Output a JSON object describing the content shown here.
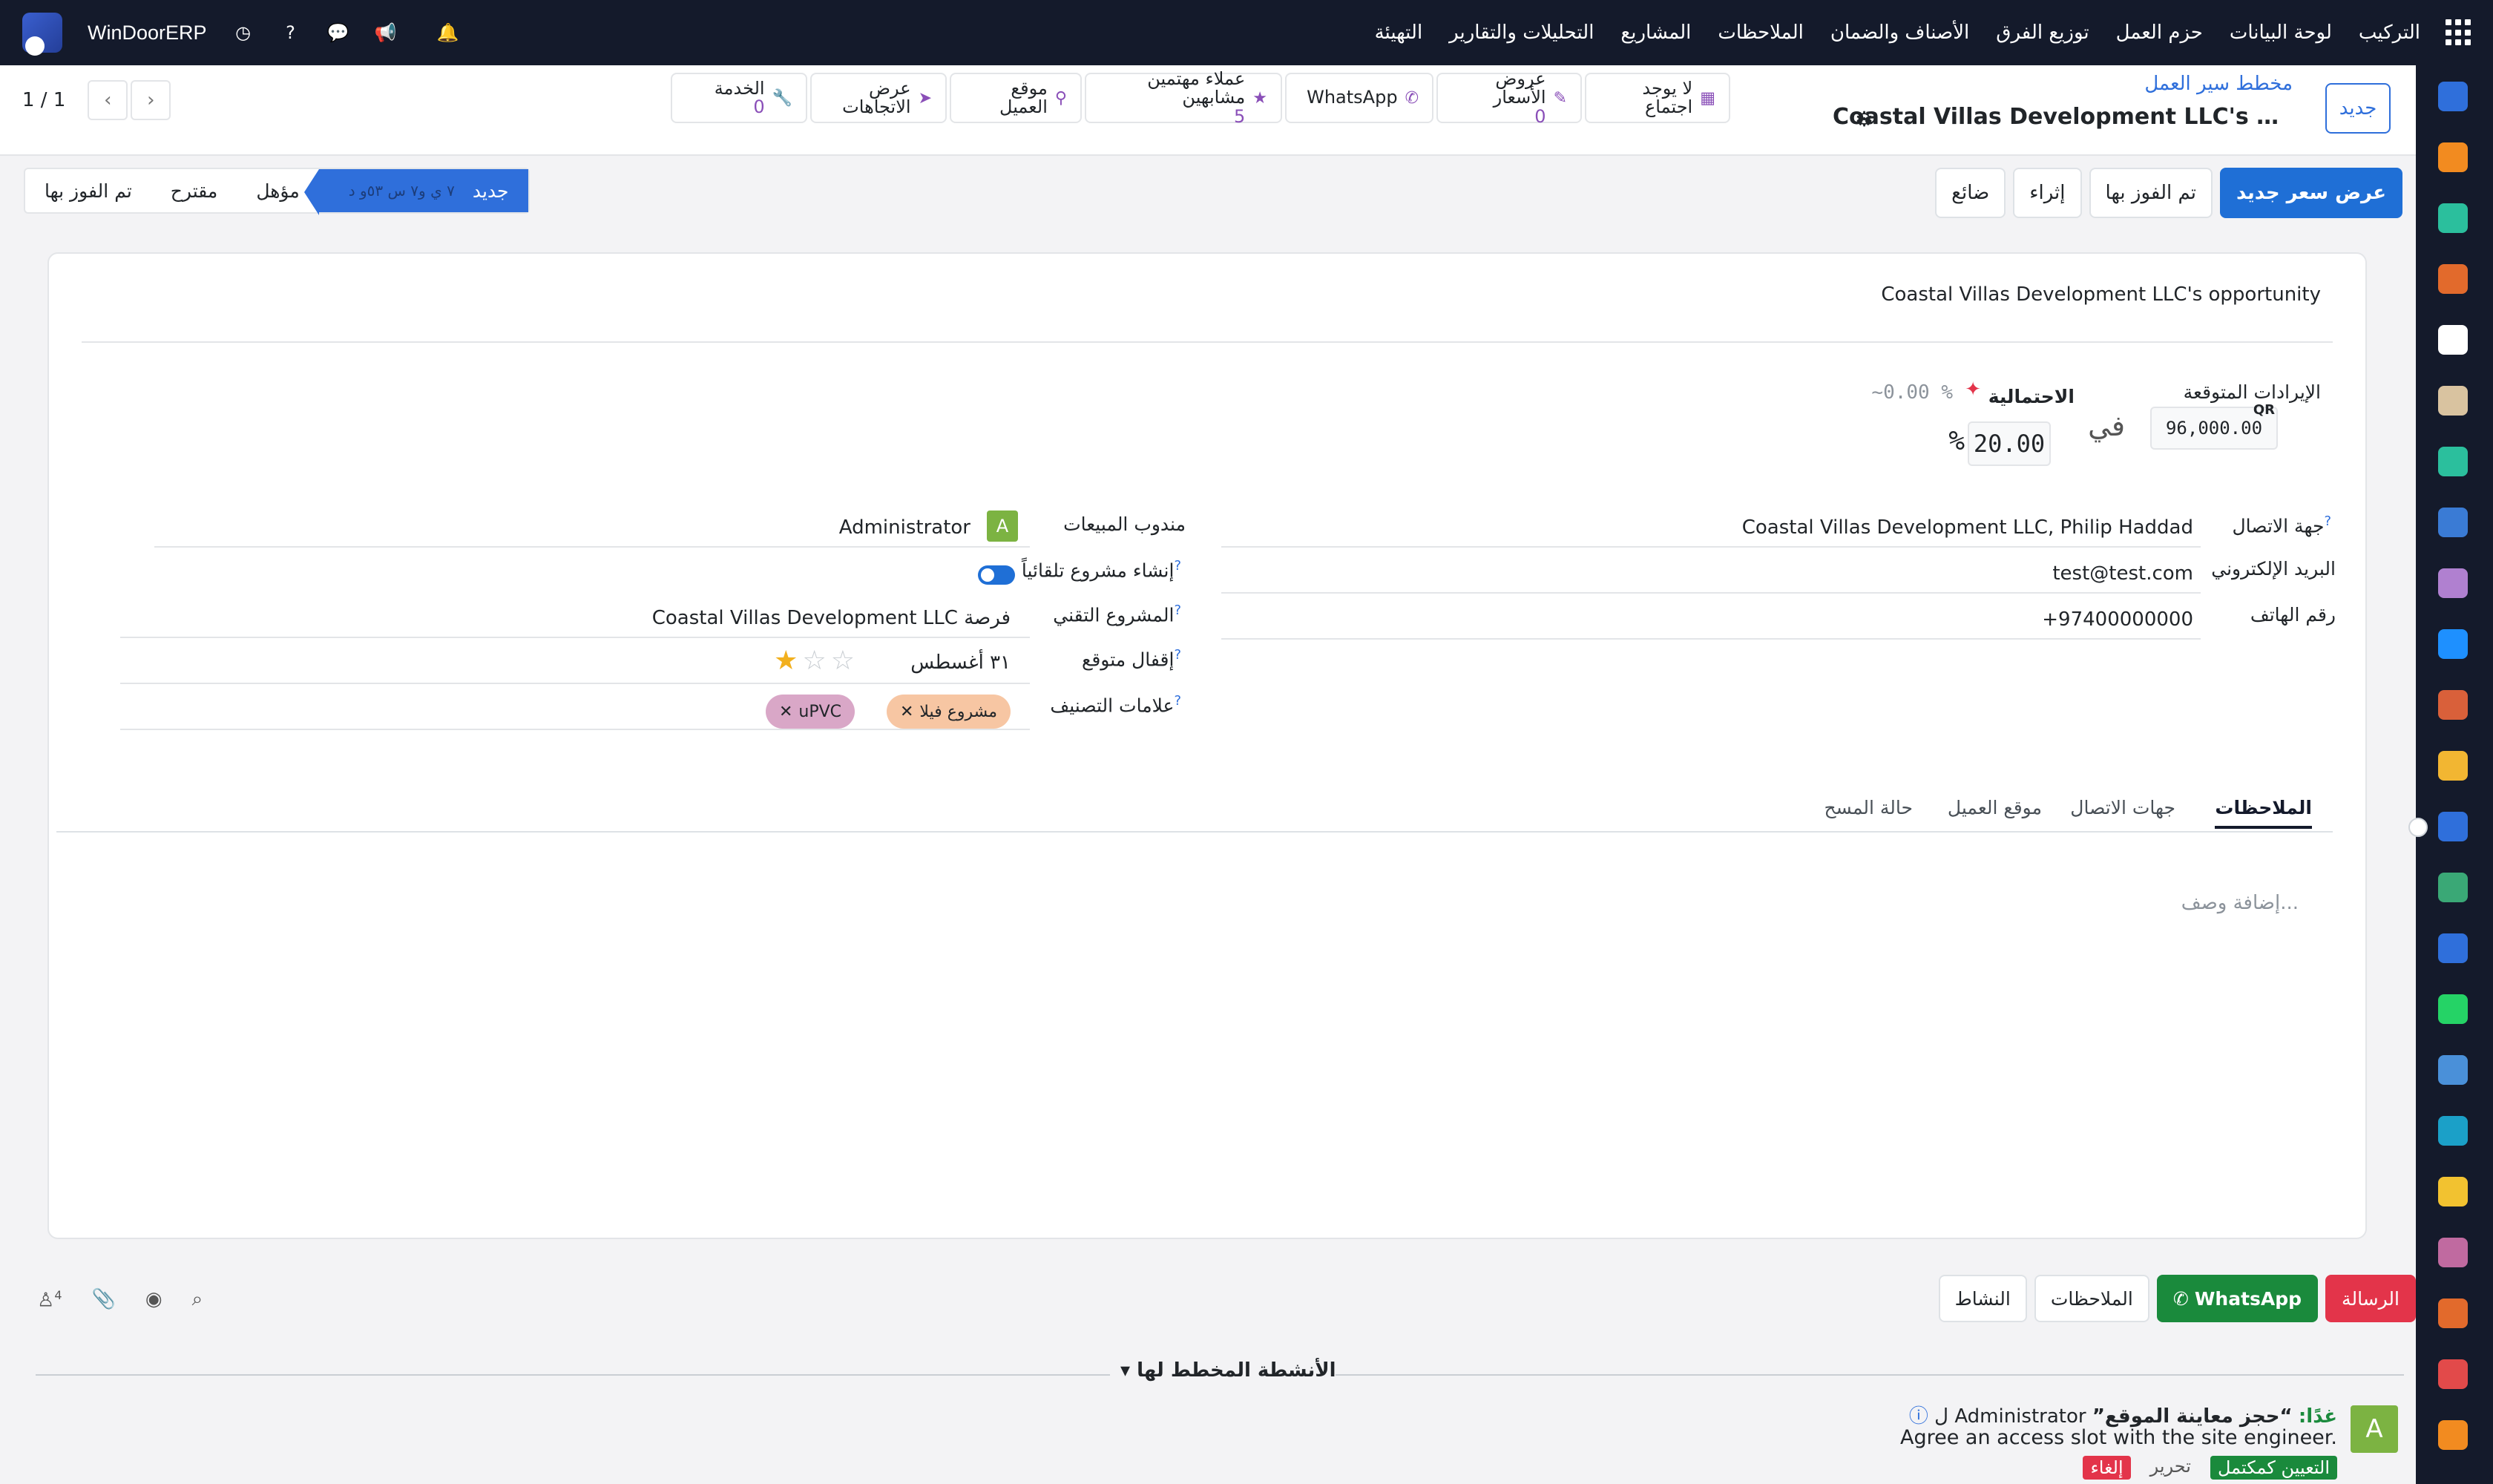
{
  "navbar": {
    "brand": "WinDoorERP",
    "menu": [
      "التركيب",
      "لوحة البيانات",
      "حزم العمل",
      "توزيع الفرق",
      "الأصناف والضمان",
      "الملاحظات",
      "المشاريع",
      "التحليلات والتقارير",
      "التهيئة"
    ]
  },
  "control": {
    "new_label": "جديد",
    "breadcrumb_parent": "مخطط سير العمل",
    "breadcrumb_current": "Coastal Villas Development LLC's opportunity",
    "stats": [
      {
        "icon": "calendar-icon",
        "label": "لا يوجد اجتماع",
        "value": ""
      },
      {
        "icon": "edit-icon",
        "label": "عروض الأسعار",
        "value": "0"
      },
      {
        "icon": "whatsapp-icon",
        "label": "WhatsApp",
        "value": ""
      },
      {
        "icon": "star-icon",
        "label": "عملاء مهتمين مشابهين",
        "value": "5"
      },
      {
        "icon": "map-pin-icon",
        "label": "موقع العميل",
        "value": ""
      },
      {
        "icon": "direction-icon",
        "label": "عرض الاتجاهات",
        "value": ""
      },
      {
        "icon": "wrench-icon",
        "label": "الخدمة",
        "value": "0"
      }
    ],
    "pager": "1 / 1"
  },
  "actions": [
    "عرض سعر جديد",
    "تم الفوز بها",
    "إثراء",
    "ضائع"
  ],
  "stages": {
    "items": [
      "تم الفوز بها",
      "مقترح",
      "مؤهل"
    ],
    "active": "جديد",
    "active_sub": "٧ ي و٧ س ٥٣و د"
  },
  "form": {
    "opportunity_name": "Coastal Villas Development LLC's opportunity",
    "expected_revenue_label": "الإيرادات المتوقعة",
    "currency": "QR",
    "expected_revenue": "96,000.00",
    "in_label": "في",
    "probability_value": "20.00",
    "percent_sign": "%",
    "probability_label": "الاحتمالية",
    "probability_auto": "~0.00 %",
    "contact_label": "جهة الاتصال",
    "contact_value": "Coastal Villas Development LLC, Philip Haddad",
    "email_label": "البريد الإلكتروني",
    "email_value": "test@test.com",
    "phone_label": "رقم الهاتف",
    "phone_value": "+97400000000",
    "salesperson_label": "مندوب المبيعات",
    "salesperson_value": "Administrator",
    "salesperson_initial": "A",
    "auto_project_label": "إنشاء مشروع تلقائياً",
    "tech_project_label": "المشروع التقني",
    "tech_project_value": "فرصة Coastal Villas Development LLC",
    "expected_close_label": "إقفال متوقع",
    "expected_close_value": "٣١ أغسطس",
    "priority_stars": 1,
    "tags_label": "علامات التصنيف",
    "tags": [
      {
        "label": "مشروع فيلا",
        "color": "#f7c6a3"
      },
      {
        "label": "uPVC",
        "color": "#d9a7c7"
      }
    ]
  },
  "tabs": [
    "الملاحظات",
    "جهات الاتصال",
    "موقع العميل",
    "حالة المسح"
  ],
  "description_placeholder": "إضافة وصف...",
  "chatter": {
    "buttons": [
      "الرسالة",
      "WhatsApp",
      "الملاحظات",
      "النشاط"
    ],
    "followers": "4",
    "planned_title": "الأنشطة المخطط لها",
    "activity": {
      "when": "غدًا:",
      "title": "“حجز معاينة الموقع”",
      "user": "Administrator ل",
      "note": "Agree an access slot with the site engineer.",
      "done": "التعيين كمكتمل",
      "edit": "تحرير",
      "cancel": "إلغاء",
      "initial": "A"
    }
  },
  "appbar_colors": [
    "#2f6fdb",
    "#f28b20",
    "#2bbf9d",
    "#e26a2c",
    "#ffffff",
    "#d9c3a0",
    "#2bbf9d",
    "#3a7bd5",
    "#b080d0",
    "#1e90ff",
    "#d9603a",
    "#f2b632",
    "#2f6fdb",
    "#3aa876",
    "#2f6fdb",
    "#25d366",
    "#4a90d9",
    "#1ba0c8",
    "#f2c230",
    "#c06aa0",
    "#e26a2c",
    "#e24a4a",
    "#f28b20"
  ]
}
